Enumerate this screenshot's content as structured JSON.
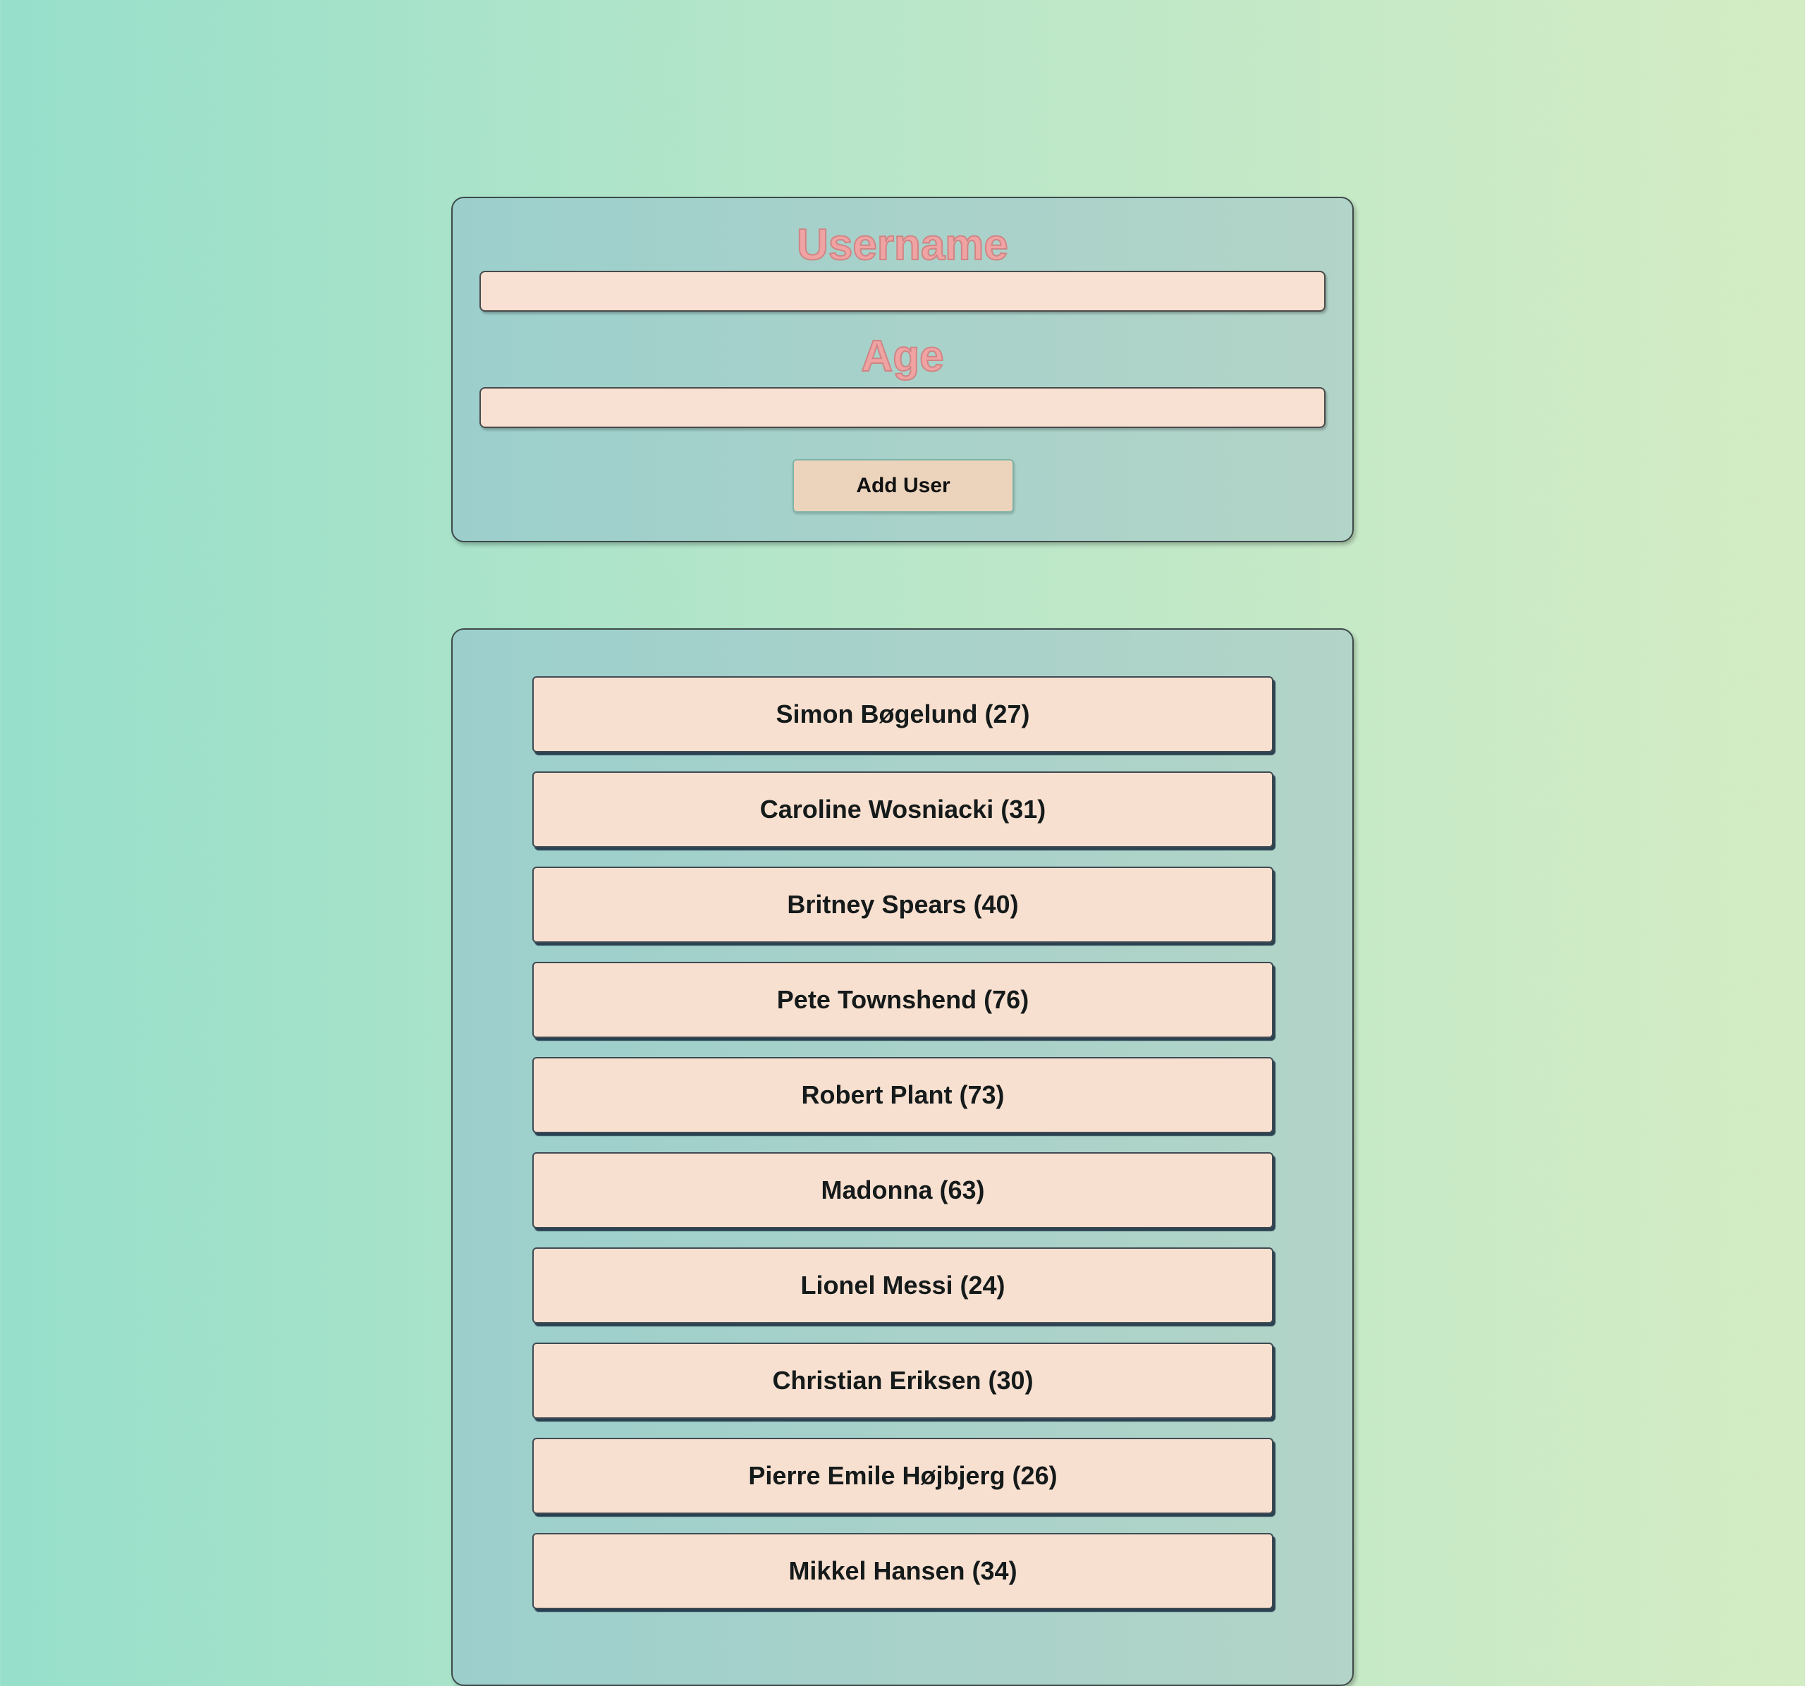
{
  "form": {
    "username_label": "Username",
    "username_value": "",
    "age_label": "Age",
    "age_value": "",
    "add_button_label": "Add User"
  },
  "users": [
    {
      "label": "Simon Bøgelund (27)"
    },
    {
      "label": "Caroline Wosniacki (31)"
    },
    {
      "label": "Britney Spears (40)"
    },
    {
      "label": "Pete Townshend (76)"
    },
    {
      "label": "Robert Plant (73)"
    },
    {
      "label": "Madonna (63)"
    },
    {
      "label": "Lionel Messi (24)"
    },
    {
      "label": "Christian Eriksen (30)"
    },
    {
      "label": "Pierre Emile Højbjerg (26)"
    },
    {
      "label": "Mikkel Hansen (34)"
    }
  ],
  "icons": {
    "username_field_icon": "password-manager-icon"
  },
  "colors": {
    "label_text": "#f0a3a3",
    "input_background": "#f8e0d2",
    "button_background": "#ebd3bc",
    "list_item_background": "#f8e0d0"
  }
}
